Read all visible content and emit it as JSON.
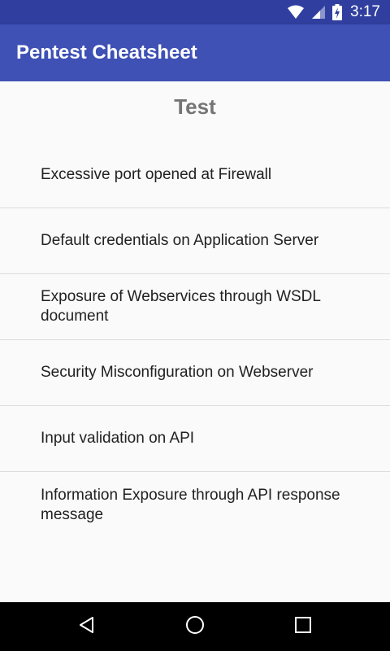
{
  "status_bar": {
    "time": "3:17",
    "icons": [
      "wifi-icon",
      "cell-signal-icon",
      "battery-charging-icon"
    ]
  },
  "app_bar": {
    "title": "Pentest Cheatsheet"
  },
  "content": {
    "section_title": "Test",
    "items": [
      {
        "label": "Excessive port opened at Firewall"
      },
      {
        "label": "Default credentials on Application Server"
      },
      {
        "label": "Exposure of Webservices through WSDL document"
      },
      {
        "label": "Security Misconfiguration on Webserver"
      },
      {
        "label": "Input validation on API"
      },
      {
        "label": "Information Exposure through API response message"
      }
    ]
  },
  "nav_bar": {
    "icons": [
      "back-icon",
      "home-icon",
      "recents-icon"
    ]
  },
  "colors": {
    "primary": "#3f51b5",
    "primary_dark": "#303f9f",
    "background": "#fafafa",
    "title_gray": "#757575"
  }
}
